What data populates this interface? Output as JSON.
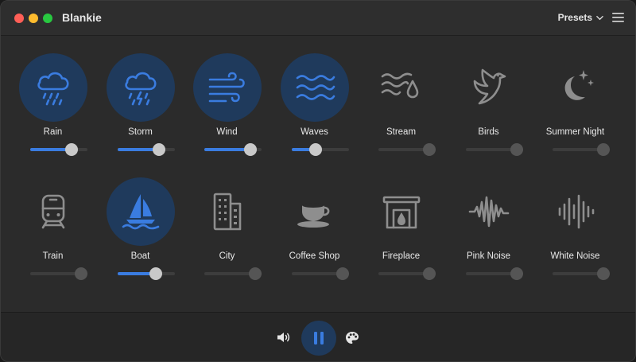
{
  "app": {
    "title": "Blankie"
  },
  "header": {
    "presets_label": "Presets"
  },
  "colors": {
    "accent": "#3a7ce0",
    "active_bg": "#1f3a5c",
    "inactive_icon": "#8e8e8e"
  },
  "sounds": [
    {
      "label": "Rain",
      "icon": "rain-icon",
      "active": true,
      "volume": 0.72
    },
    {
      "label": "Storm",
      "icon": "storm-icon",
      "active": true,
      "volume": 0.72
    },
    {
      "label": "Wind",
      "icon": "wind-icon",
      "active": true,
      "volume": 0.8
    },
    {
      "label": "Waves",
      "icon": "waves-icon",
      "active": true,
      "volume": 0.42
    },
    {
      "label": "Stream",
      "icon": "stream-icon",
      "active": false,
      "volume": 0.89
    },
    {
      "label": "Birds",
      "icon": "bird-icon",
      "active": false,
      "volume": 0.89
    },
    {
      "label": "Summer Night",
      "icon": "moon-icon",
      "active": false,
      "volume": 0.89
    },
    {
      "label": "Train",
      "icon": "train-icon",
      "active": false,
      "volume": 0.89
    },
    {
      "label": "Boat",
      "icon": "sailboat-icon",
      "active": true,
      "volume": 0.66
    },
    {
      "label": "City",
      "icon": "building-icon",
      "active": false,
      "volume": 0.89
    },
    {
      "label": "Coffee Shop",
      "icon": "coffee-cup-icon",
      "active": false,
      "volume": 0.89
    },
    {
      "label": "Fireplace",
      "icon": "fireplace-icon",
      "active": false,
      "volume": 0.89
    },
    {
      "label": "Pink Noise",
      "icon": "waveform-icon",
      "active": false,
      "volume": 0.89
    },
    {
      "label": "White Noise",
      "icon": "waveform-bars-icon",
      "active": false,
      "volume": 0.89
    }
  ],
  "controls": {
    "playing": true
  }
}
